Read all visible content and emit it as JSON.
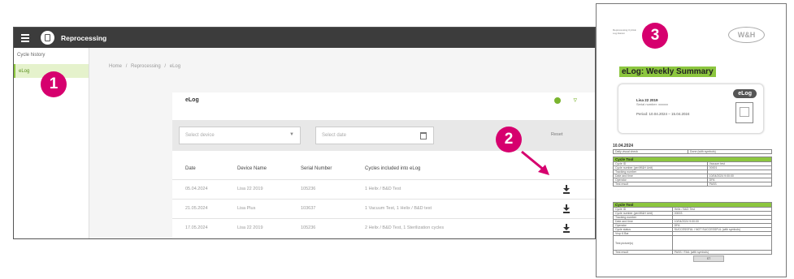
{
  "app": {
    "title": "Reprocessing",
    "sidebar": {
      "items": [
        {
          "label": "Cycle history"
        },
        {
          "label": "eLog"
        }
      ]
    },
    "breadcrumb": [
      "Home",
      "/",
      "Reprocessing",
      "/",
      "eLog"
    ],
    "panel": {
      "title": "eLog",
      "device_placeholder": "Select device",
      "date_placeholder": "Select date",
      "reset_label": "Reset",
      "columns": [
        "Date",
        "Device Name",
        "Serial Number",
        "Cycles included into eLog"
      ],
      "rows": [
        {
          "date": "05.04.2024",
          "device": "Lisa 22 2019",
          "serial": "105236",
          "cycles": "1 Helix / B&D Test"
        },
        {
          "date": "21.05.2024",
          "device": "Lisa Plus",
          "serial": "103637",
          "cycles": "1 Vacuum Test, 1 Helix / B&D test"
        },
        {
          "date": "17.05.2024",
          "device": "Lisa 22 2019",
          "serial": "105236",
          "cycles": "2 Helix / B&D Test, 1 Sterilization cycles"
        }
      ]
    }
  },
  "callouts": [
    "1",
    "2",
    "3"
  ],
  "document": {
    "header_small": "Reprocessing\nCyCLE Log\nAlanon",
    "logo_text": "W&H",
    "title": "eLog: Weekly Summary",
    "badge": "eLog",
    "device": "Lisa 22 2019",
    "serial": "Serial number: xxxxxx",
    "period": "Period: 10.04.2024 – 15.04.2024",
    "date": "10.04.2024",
    "check_row": {
      "label": "Daily visual check",
      "value": "Done (with symbols)"
    },
    "section1": {
      "header": "Cycle Tool",
      "rows": [
        {
          "label": "Cycle ID",
          "value": "Vacuum test"
        },
        {
          "label": "Cycle number (per/W&H Unit)",
          "value": "00001"
        },
        {
          "label": "Tracking number",
          "value": ""
        },
        {
          "label": "Date and time",
          "value": "10/04/2024 9:00:00"
        },
        {
          "label": "Operator",
          "value": "DFA"
        },
        {
          "label": "Test result",
          "value": "PASS"
        }
      ]
    },
    "section2": {
      "header": "Cycle Tool",
      "rows": [
        {
          "label": "Cycle ID",
          "value": "Helix / B&D Test"
        },
        {
          "label": "Cycle number (per/W&H Unit)",
          "value": "00003"
        },
        {
          "label": "Tracking number",
          "value": ""
        },
        {
          "label": "Date and time",
          "value": "10/04/2024 9:00:00"
        },
        {
          "label": "Operator",
          "value": "DFA"
        },
        {
          "label": "Cycle status",
          "value": "SUCCESSFUL / NOT SUCCESSFUL (with symbols)"
        },
        {
          "label": "Vrop 6 Bar",
          "value": ""
        },
        {
          "label": "Test picture(s)",
          "value": ""
        },
        {
          "label": "Test result",
          "value": "PASS / FAIL (with symbols)"
        }
      ]
    },
    "image_tile": "ST"
  }
}
